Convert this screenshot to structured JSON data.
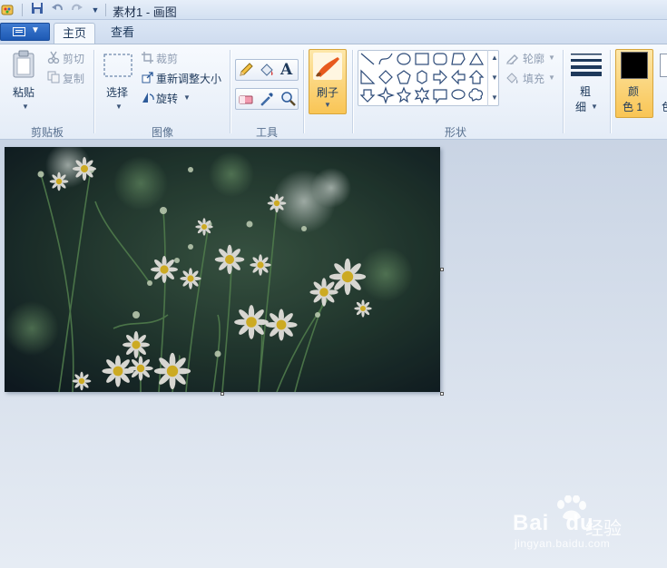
{
  "window": {
    "title": "素材1 - 画图"
  },
  "tabs": [
    {
      "label": "主页"
    },
    {
      "label": "查看"
    }
  ],
  "clipboard": {
    "paste": "粘贴",
    "cut": "剪切",
    "copy": "复制",
    "group": "剪贴板"
  },
  "image_group": {
    "select": "选择",
    "crop": "裁剪",
    "resize": "重新调整大小",
    "rotate": "旋转",
    "group": "图像"
  },
  "tools": {
    "group": "工具"
  },
  "brushes": {
    "label": "刷子"
  },
  "shapes": {
    "group": "形状",
    "outline": "轮廓",
    "fill": "填充"
  },
  "size": {
    "label_line1": "粗",
    "label_line2": "细"
  },
  "color1": {
    "label_line1": "颜",
    "label_line2": "色 1",
    "value": "#000000"
  },
  "color2": {
    "label_partial": "色"
  },
  "watermark": {
    "brand": "Bai",
    "brand_end": "du",
    "cn": "经验",
    "url": "jingyan.baidu.com"
  },
  "colors": {
    "accent": "#fbd27a",
    "canvas_bg": "#dfe6f0",
    "ribbon_bg": "#eef3fa"
  }
}
